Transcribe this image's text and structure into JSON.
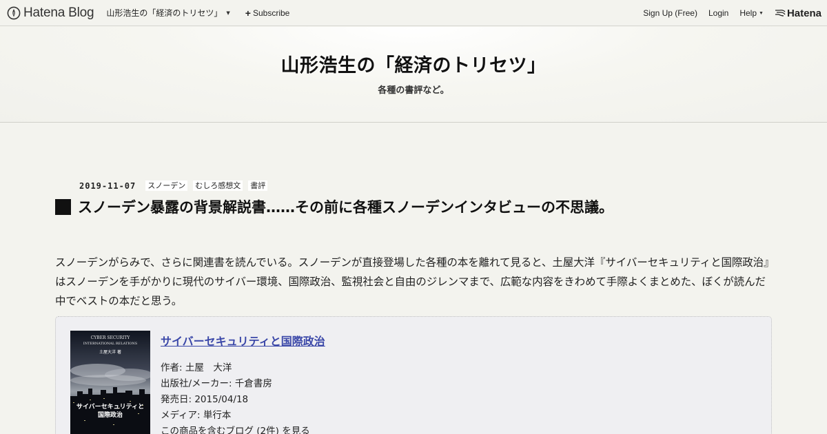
{
  "globalbar": {
    "brand": "Hatena Blog",
    "blog_menu": "山形浩生の「経済のトリセツ」",
    "subscribe": "Subscribe",
    "signup": "Sign Up (Free)",
    "login": "Login",
    "help": "Help",
    "hatena": "Hatena"
  },
  "header": {
    "title": "山形浩生の「経済のトリセツ」",
    "description": "各種の書評など。"
  },
  "entry": {
    "date": "2019-11-07",
    "categories": [
      "スノーデン",
      "むしろ感想文",
      "書評"
    ],
    "title": "スノーデン暴露の背景解説書……その前に各種スノーデンインタビューの不思議。",
    "body": "スノーデンがらみで、さらに関連書を読んでいる。スノーデンが直接登場した各種の本を離れて見ると、土屋大洋『サイバーセキュリティと国際政治』はスノーデンを手がかりに現代のサイバー環境、国際政治、監視社会と自由のジレンマまで、広範な内容をきわめて手際よくまとめた、ぼくが読んだ中でベストの本だと思う。"
  },
  "product": {
    "title": "サイバーセキュリティと国際政治",
    "author": "作者: 土屋　大洋",
    "publisher": "出版社/メーカー: 千倉書房",
    "release": "発売日: 2015/04/18",
    "media": "メディア: 単行本",
    "blogs": "この商品を含むブログ (2件) を見る",
    "cover_text": {
      "top_line1": "CYBER SECURITY",
      "top_line2": "INTERNATIONAL RELATIONS",
      "author": "土屋大洋 著",
      "title_line1": "サイバーセキュリティと",
      "title_line2": "国際政治"
    }
  },
  "colors": {
    "background": "#f3f3ee",
    "link": "#3a47a8",
    "product_box": "#efeff2"
  }
}
